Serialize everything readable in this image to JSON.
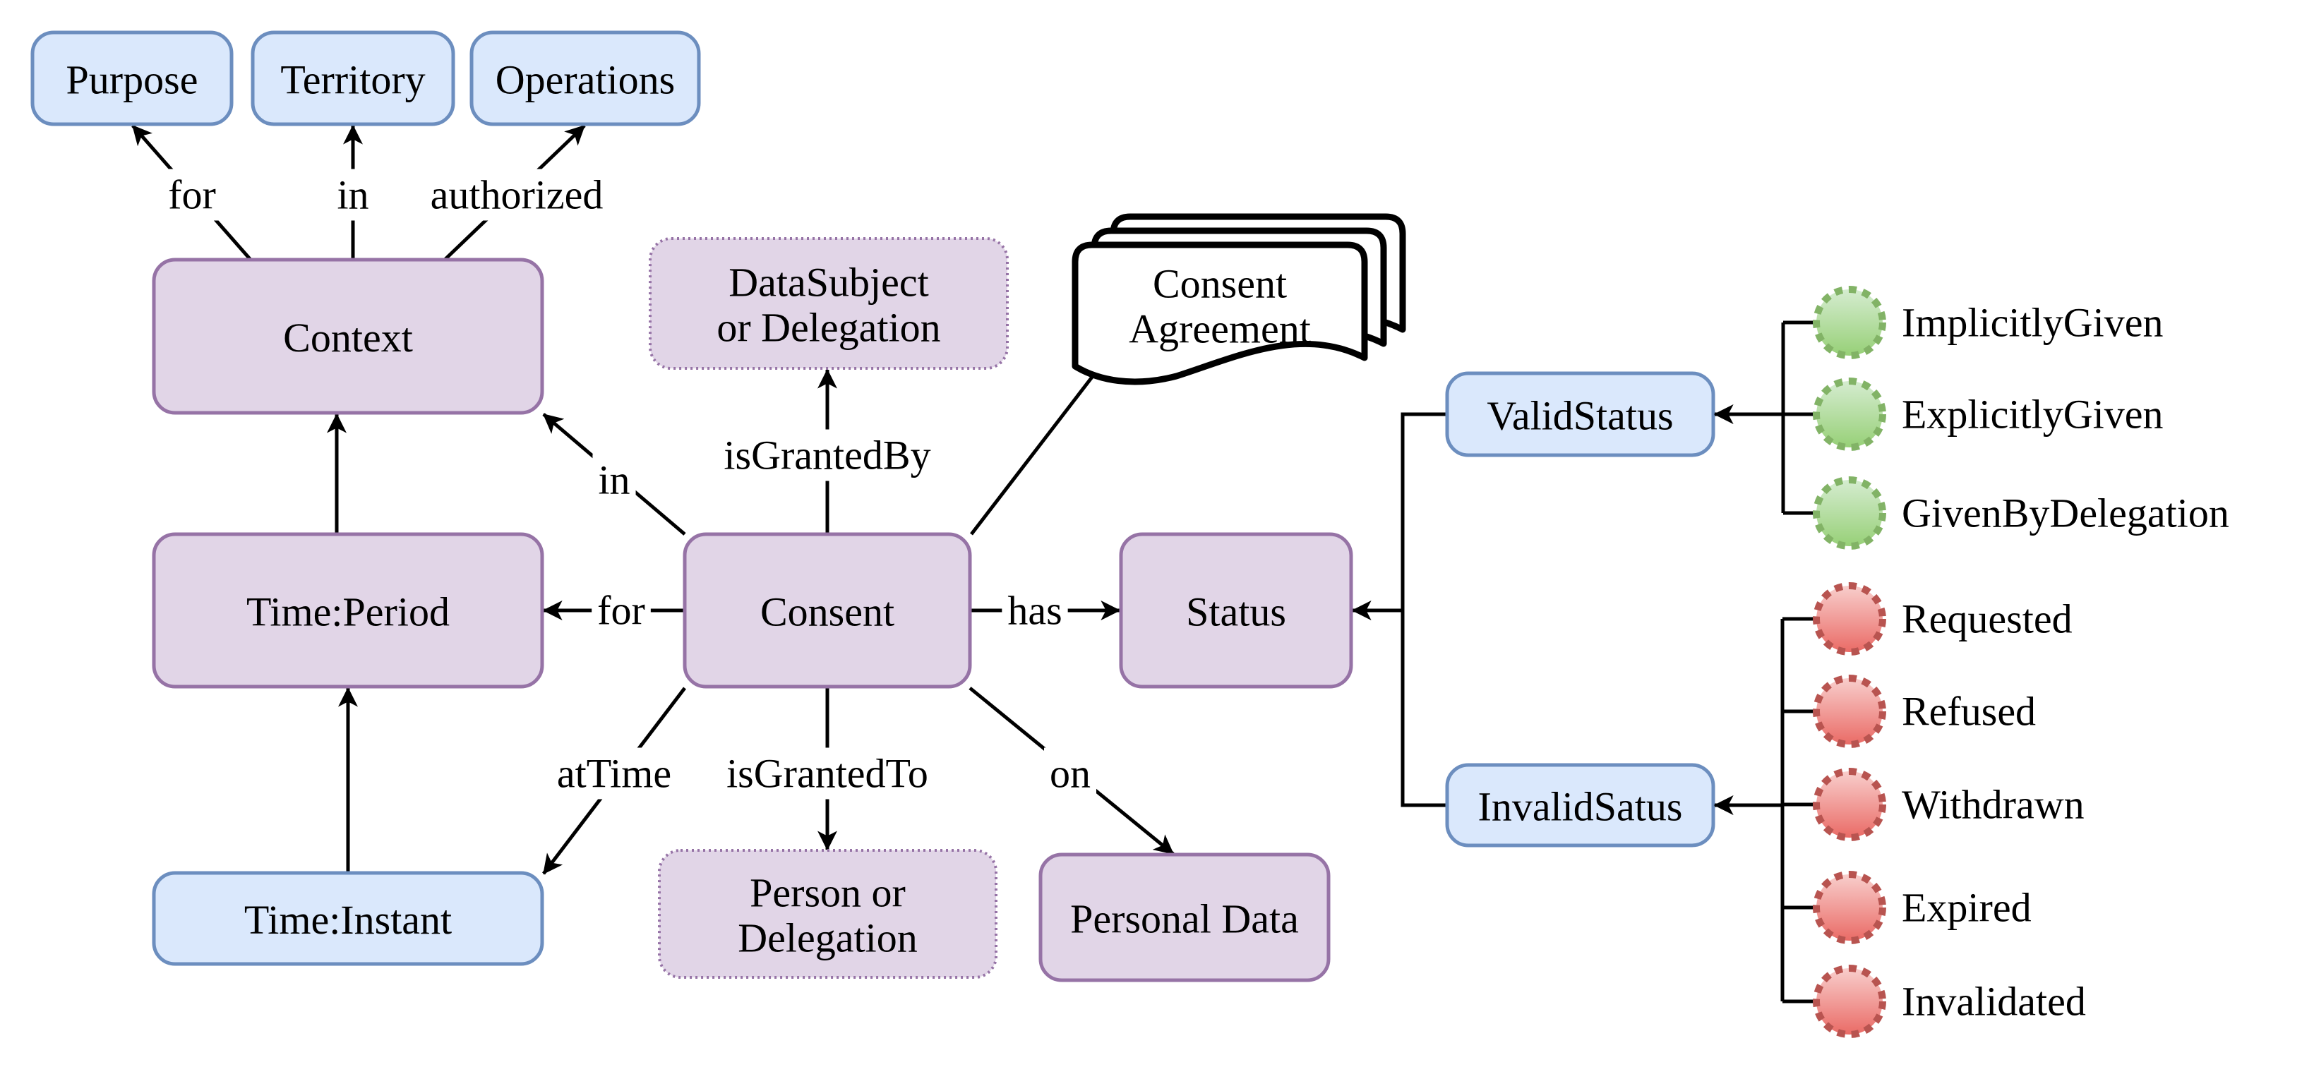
{
  "colors": {
    "purple_fill": "#e1d5e7",
    "purple_stroke": "#9673a6",
    "blue_fill": "#dae8fc",
    "blue_stroke": "#6c8ebf",
    "green_fill_top": "#d5ecd0",
    "green_fill_bottom": "#97d077",
    "green_stroke": "#82b366",
    "red_fill_top": "#f8cecc",
    "red_fill_bottom": "#ea6b66",
    "red_stroke": "#b85450",
    "line": "#000000"
  },
  "nodes": {
    "purpose": {
      "label": [
        "Purpose"
      ],
      "style": "blue"
    },
    "territory": {
      "label": [
        "Territory"
      ],
      "style": "blue"
    },
    "operations": {
      "label": [
        "Operations"
      ],
      "style": "blue"
    },
    "context": {
      "label": [
        "Context"
      ],
      "style": "purple"
    },
    "time_period": {
      "label": [
        "Time:Period"
      ],
      "style": "purple"
    },
    "time_instant": {
      "label": [
        "Time:Instant"
      ],
      "style": "blue"
    },
    "data_subject": {
      "label": [
        "DataSubject",
        "or Delegation"
      ],
      "style": "purple-dotted"
    },
    "consent": {
      "label": [
        "Consent"
      ],
      "style": "purple"
    },
    "person": {
      "label": [
        "Person or",
        "Delegation"
      ],
      "style": "purple-dotted"
    },
    "personal_data": {
      "label": [
        "Personal Data"
      ],
      "style": "purple"
    },
    "status": {
      "label": [
        "Status"
      ],
      "style": "purple"
    },
    "valid_status": {
      "label": [
        "ValidStatus"
      ],
      "style": "blue"
    },
    "invalid_status": {
      "label": [
        "InvalidSatus"
      ],
      "style": "blue"
    },
    "consent_agreement": {
      "label": [
        "Consent",
        "Agreement"
      ],
      "style": "document-multi"
    }
  },
  "edges": [
    {
      "id": "context-purpose",
      "from": "context",
      "to": "purpose",
      "label": "for",
      "arrow": true
    },
    {
      "id": "context-territory",
      "from": "context",
      "to": "territory",
      "label": "in",
      "arrow": true
    },
    {
      "id": "context-operations",
      "from": "context",
      "to": "operations",
      "label": "authorized",
      "arrow": true
    },
    {
      "id": "period-context",
      "from": "time_period",
      "to": "context",
      "label": "",
      "arrow": true
    },
    {
      "id": "instant-period",
      "from": "time_instant",
      "to": "time_period",
      "label": "",
      "arrow": true
    },
    {
      "id": "consent-context",
      "from": "consent",
      "to": "context",
      "label": "in",
      "arrow": true
    },
    {
      "id": "consent-period",
      "from": "consent",
      "to": "time_period",
      "label": "for",
      "arrow": true
    },
    {
      "id": "consent-instant",
      "from": "consent",
      "to": "time_instant",
      "label": "atTime",
      "arrow": true
    },
    {
      "id": "consent-subject",
      "from": "consent",
      "to": "data_subject",
      "label": "isGrantedBy",
      "arrow": true
    },
    {
      "id": "consent-person",
      "from": "consent",
      "to": "person",
      "label": "isGrantedTo",
      "arrow": true
    },
    {
      "id": "consent-personaldata",
      "from": "consent",
      "to": "personal_data",
      "label": "on",
      "arrow": true
    },
    {
      "id": "consent-status",
      "from": "consent",
      "to": "status",
      "label": "has",
      "arrow": true
    },
    {
      "id": "consent-agreement",
      "from": "consent",
      "to": "consent_agreement",
      "label": "",
      "arrow": false
    },
    {
      "id": "substatus-status",
      "from": "valid_status+invalid_status",
      "to": "status",
      "label": "",
      "arrow": true
    }
  ],
  "valid_states": {
    "parent": "valid_status",
    "color": "green",
    "items": [
      "ImplicitlyGiven",
      "ExplicitlyGiven",
      "GivenByDelegation"
    ]
  },
  "invalid_states": {
    "parent": "invalid_status",
    "color": "red",
    "items": [
      "Requested",
      "Refused",
      "Withdrawn",
      "Expired",
      "Invalidated"
    ]
  }
}
